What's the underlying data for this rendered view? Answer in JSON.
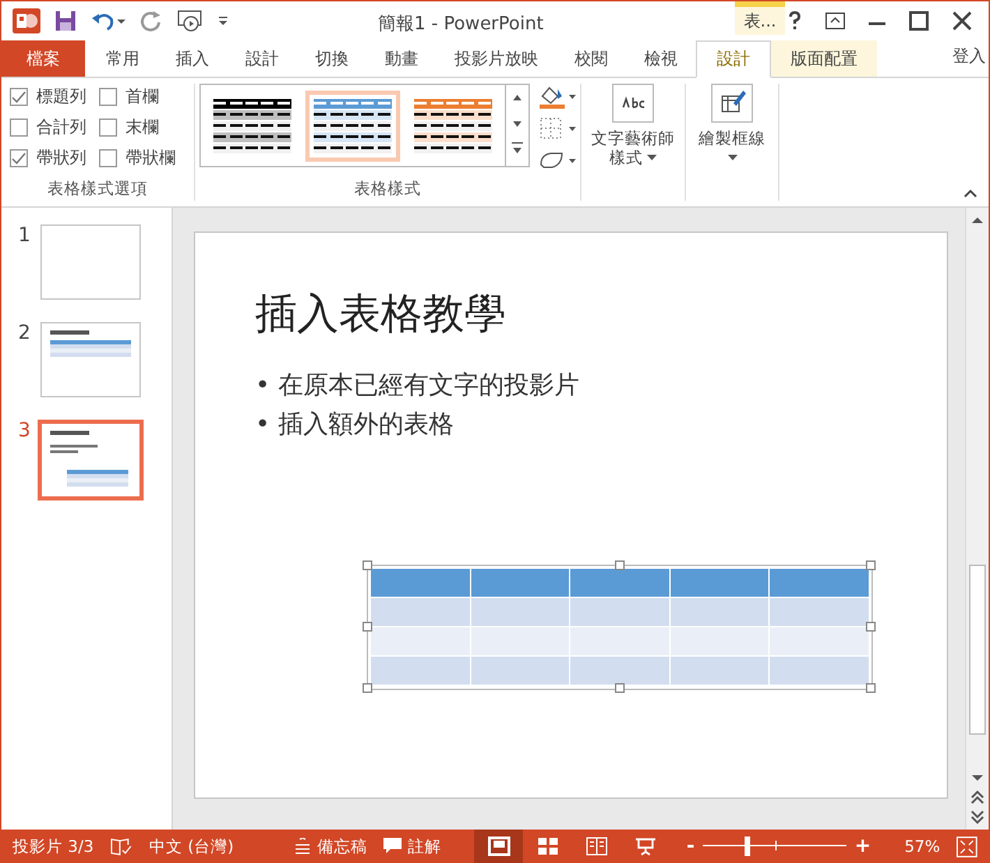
{
  "window": {
    "title": "簡報1 - PowerPoint",
    "context_tab": "表..."
  },
  "tabs": [
    {
      "label": "檔案",
      "kind": "file",
      "selected": false
    },
    {
      "label": "常用",
      "kind": "normal",
      "selected": false
    },
    {
      "label": "插入",
      "kind": "normal",
      "selected": false
    },
    {
      "label": "設計",
      "kind": "normal",
      "selected": false
    },
    {
      "label": "切換",
      "kind": "normal",
      "selected": false
    },
    {
      "label": "動畫",
      "kind": "normal",
      "selected": false
    },
    {
      "label": "投影片放映",
      "kind": "normal",
      "selected": false
    },
    {
      "label": "校閱",
      "kind": "normal",
      "selected": false
    },
    {
      "label": "檢視",
      "kind": "normal",
      "selected": false
    },
    {
      "label": "設計",
      "kind": "context",
      "selected": true
    },
    {
      "label": "版面配置",
      "kind": "context",
      "selected": false
    }
  ],
  "sign_in": "登入",
  "ribbon": {
    "options": {
      "label": "表格樣式選項",
      "items": [
        {
          "label": "標題列",
          "checked": true
        },
        {
          "label": "首欄",
          "checked": false
        },
        {
          "label": "合計列",
          "checked": false
        },
        {
          "label": "末欄",
          "checked": false
        },
        {
          "label": "帶狀列",
          "checked": true
        },
        {
          "label": "帶狀欄",
          "checked": false
        }
      ]
    },
    "styles": {
      "label": "表格樣式",
      "items": [
        {
          "color": "#000000",
          "selected": false
        },
        {
          "color": "#5b9bd5",
          "selected": true
        },
        {
          "color": "#ed7d31",
          "selected": false
        }
      ]
    },
    "wordart": {
      "line1": "文字藝術師",
      "line2": "樣式"
    },
    "draw_borders": {
      "label": "繪製框線"
    }
  },
  "slides": [
    {
      "number": "1",
      "kind": "blank",
      "selected": false
    },
    {
      "number": "2",
      "kind": "table",
      "selected": false
    },
    {
      "number": "3",
      "kind": "full",
      "selected": true
    }
  ],
  "slide": {
    "title": "插入表格教學",
    "bullets": [
      "• 在原本已經有文字的投影片",
      "• 插入額外的表格"
    ]
  },
  "status_bar": {
    "slide": "投影片 3/3",
    "language": "中文 (台灣)",
    "notes": "備忘稿",
    "comments": "註解",
    "views": [
      {
        "kind": "normal",
        "selected": true
      },
      {
        "kind": "sorter",
        "selected": false
      },
      {
        "kind": "reading",
        "selected": false
      },
      {
        "kind": "show",
        "selected": false
      }
    ],
    "zoom": {
      "level": 0.31
    },
    "zoom_text": "57%",
    "minus": "-",
    "plus": "+"
  }
}
